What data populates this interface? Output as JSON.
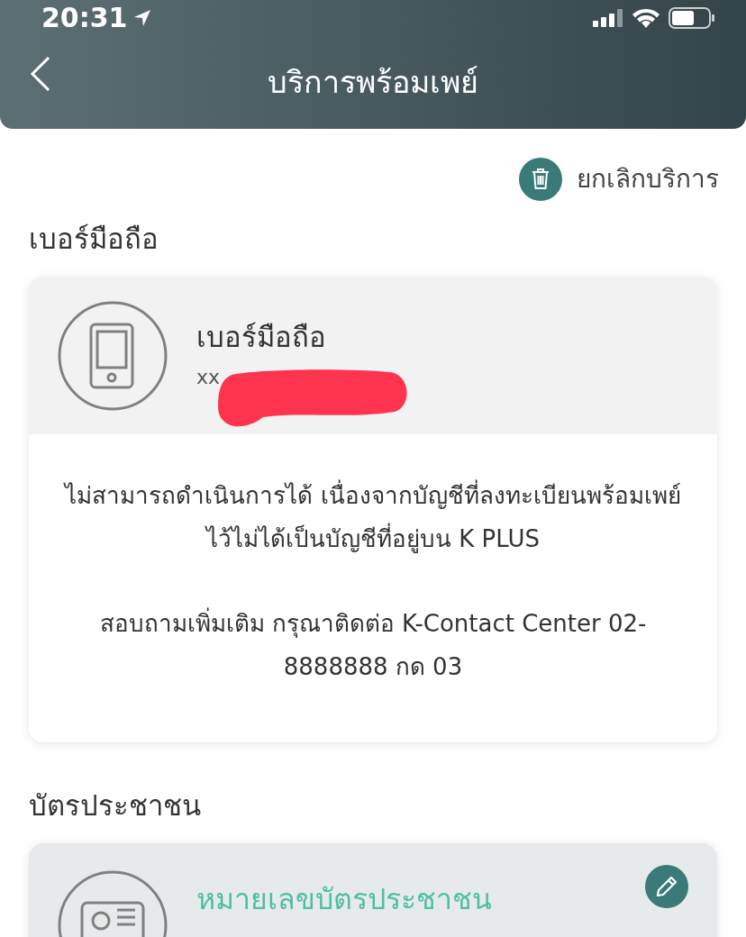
{
  "status_bar": {
    "time": "20:31"
  },
  "header": {
    "title": "บริการพร้อมเพย์"
  },
  "cancel_action": {
    "label": "ยกเลิกบริการ"
  },
  "sections": [
    {
      "kind": "mobile",
      "heading": "เบอร์มือถือ",
      "card": {
        "title": "เบอร์มือถือ",
        "value": "xx",
        "redacted": true,
        "messages": [
          "ไม่สามารถดำเนินการได้ เนื่องจากบัญชีที่ลงทะเบียนพร้อมเพย์ไว้ไม่ได้เป็นบัญชีที่อยู่บน K PLUS",
          "สอบถามเพิ่มเติม กรุณาติดต่อ K-Contact Center 02-8888888 กด 03"
        ]
      }
    },
    {
      "kind": "id_card",
      "heading": "บัตรประชาชน",
      "card": {
        "title": "หมายเลขบัตรประชาชน",
        "editable": true
      }
    }
  ]
}
